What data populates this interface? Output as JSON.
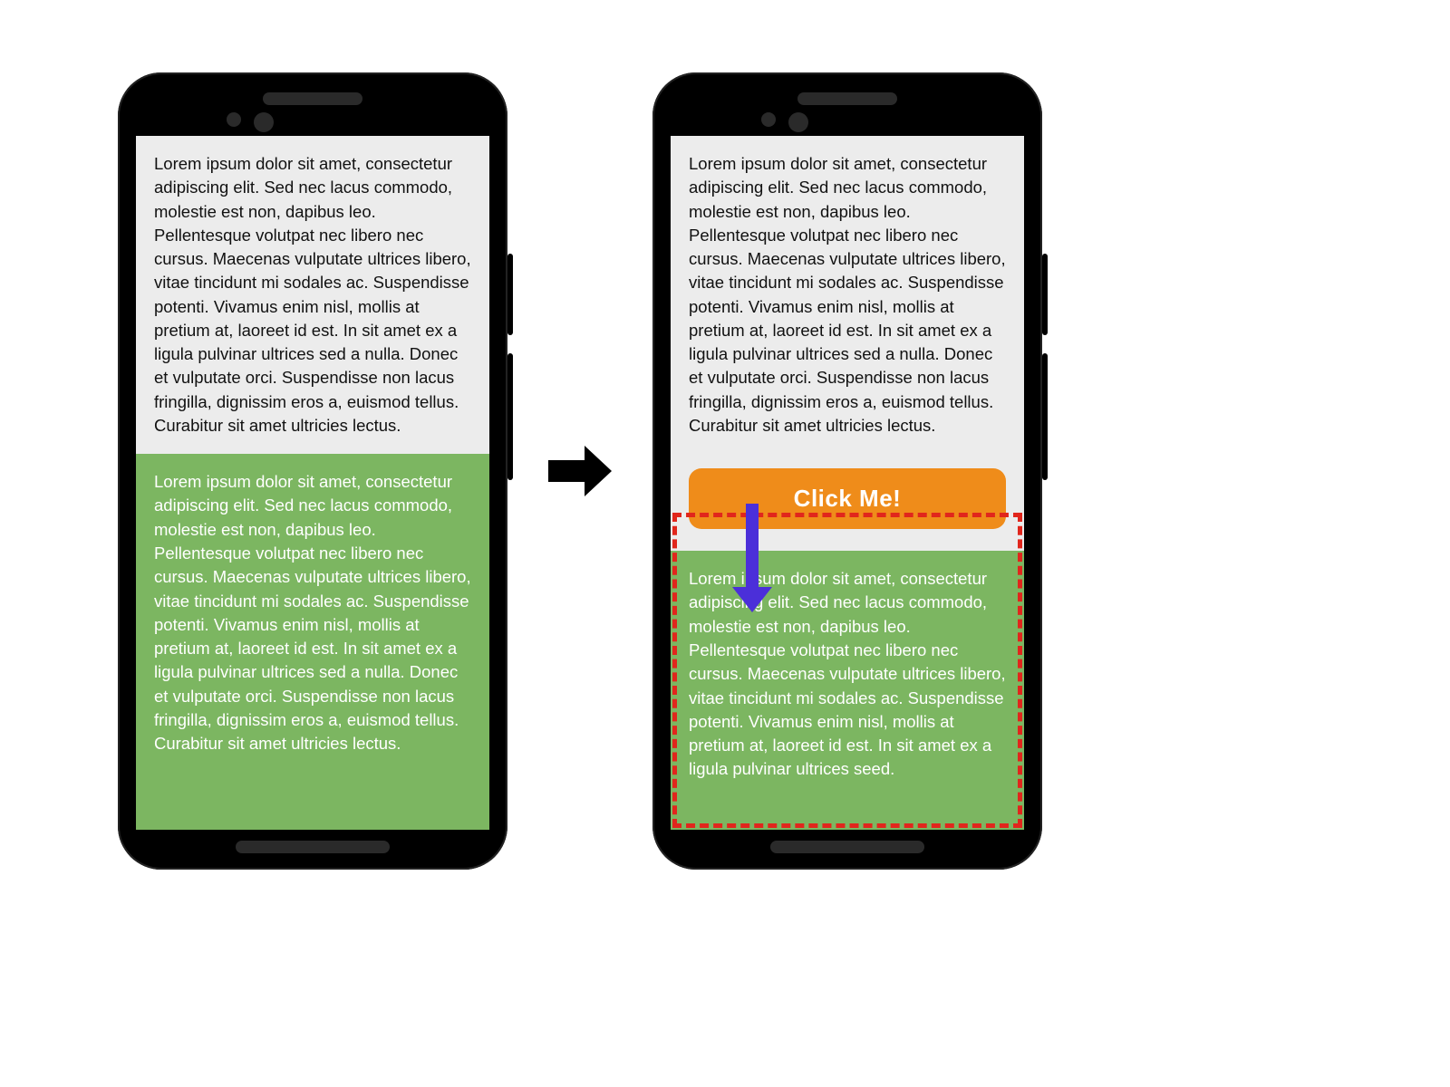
{
  "left": {
    "para1": "Lorem ipsum dolor sit amet, consectetur adipiscing elit. Sed nec lacus commodo, molestie est non, dapibus leo. Pellentesque volutpat nec libero nec cursus. Maecenas vulputate ultrices libero, vitae tincidunt mi sodales ac. Suspendisse potenti. Vivamus enim nisl, mollis at pretium at, laoreet id est. In sit amet ex a ligula pulvinar ultrices sed a nulla. Donec et vulputate orci. Suspendisse non lacus fringilla, dignissim eros a, euismod tellus. Curabitur sit amet ultricies lectus.",
    "para2": "Lorem ipsum dolor sit amet, consectetur adipiscing elit. Sed nec lacus commodo, molestie est non, dapibus leo. Pellentesque volutpat nec libero nec cursus. Maecenas vulputate ultrices libero, vitae tincidunt mi sodales ac. Suspendisse potenti. Vivamus enim nisl, mollis at pretium at, laoreet id est. In sit amet ex a ligula pulvinar ultrices sed a nulla. Donec et vulputate orci. Suspendisse non lacus fringilla, dignissim eros a, euismod tellus. Curabitur sit amet ultricies lectus."
  },
  "right": {
    "para1": "Lorem ipsum dolor sit amet, consectetur adipiscing elit. Sed nec lacus commodo, molestie est non, dapibus leo. Pellentesque volutpat nec libero nec cursus. Maecenas vulputate ultrices libero, vitae tincidunt mi sodales ac. Suspendisse potenti. Vivamus enim nisl, mollis at pretium at, laoreet id est. In sit amet ex a ligula pulvinar ultrices sed a nulla. Donec et vulputate orci. Suspendisse non lacus fringilla, dignissim eros a, euismod tellus. Curabitur sit amet ultricies lectus.",
    "button_label": "Click Me!",
    "para2": "Lorem ipsum dolor sit amet, consectetur adipiscing elit. Sed nec lacus commodo, molestie est non, dapibus leo. Pellentesque volutpat nec libero nec cursus. Maecenas vulputate ultrices libero, vitae tincidunt mi sodales ac. Suspendisse potenti. Vivamus enim nisl, mollis at pretium at, laoreet id est. In sit amet ex a ligula pulvinar ultrices seed."
  },
  "colors": {
    "button_bg": "#ef8c1a",
    "green_bg": "#7cb661",
    "highlight_border": "#e1261c",
    "arrow": "#4b2fd9"
  }
}
